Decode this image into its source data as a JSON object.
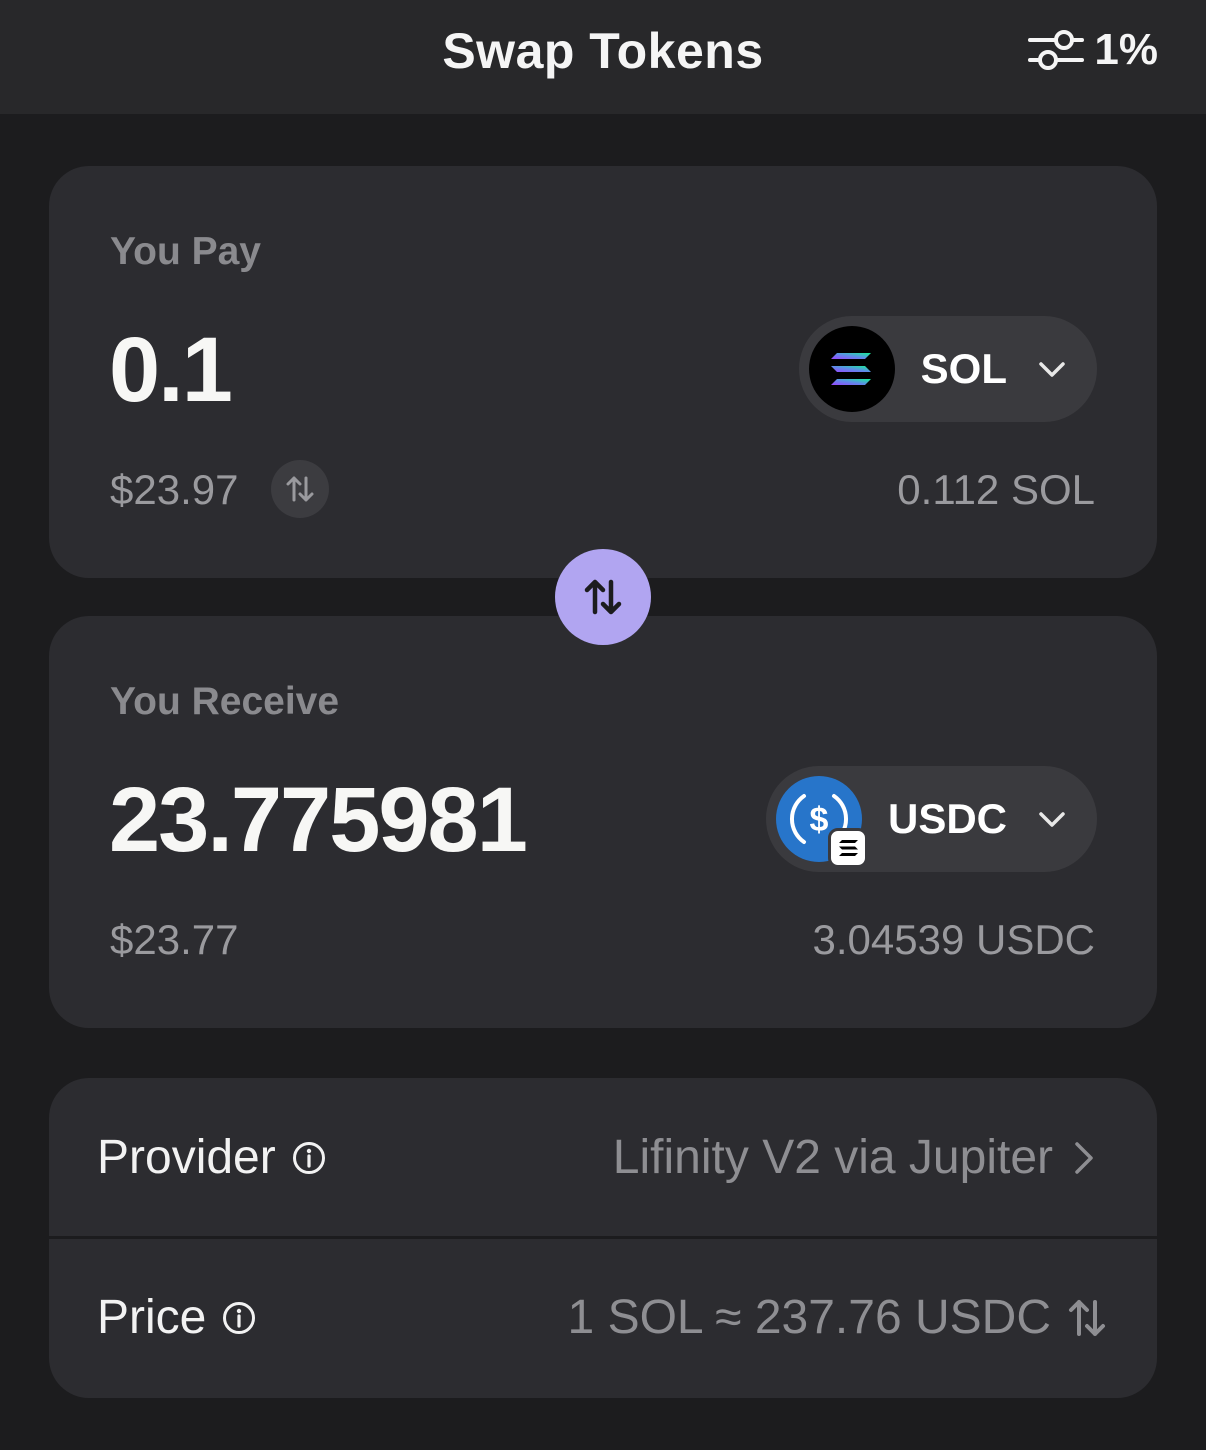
{
  "header": {
    "title": "Swap Tokens",
    "slippage": "1%",
    "slippage_icon": "sliders-icon"
  },
  "pay": {
    "label": "You Pay",
    "amount": "0.1",
    "usd_value": "$23.97",
    "token": "SOL",
    "balance": "0.112 SOL"
  },
  "receive": {
    "label": "You Receive",
    "amount": "23.775981",
    "usd_value": "$23.77",
    "token": "USDC",
    "balance": "3.04539 USDC"
  },
  "info": {
    "provider_label": "Provider",
    "provider_value": "Lifinity V2 via Jupiter",
    "price_label": "Price",
    "price_value": "1 SOL ≈ 237.76 USDC"
  },
  "colors": {
    "background": "#1c1c1e",
    "card": "#2c2c30",
    "swap_button": "#b1a5f1",
    "usdc_blue": "#2775ca"
  }
}
